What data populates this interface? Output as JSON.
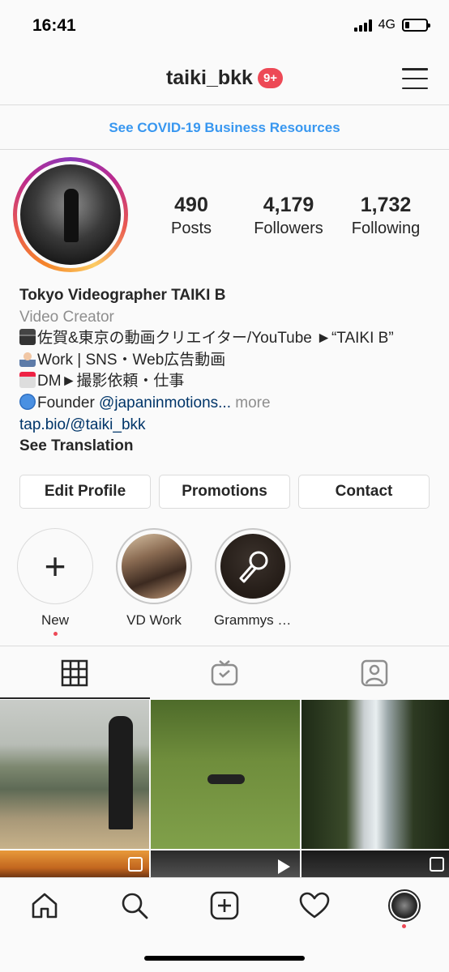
{
  "status_bar": {
    "time": "16:41",
    "network": "4G",
    "battery_level": 0.2
  },
  "header": {
    "username": "taiki_bkk",
    "notification_badge": "9+",
    "menu_icon": "hamburger-menu-icon"
  },
  "banner": {
    "text": "See COVID-19 Business Resources"
  },
  "stats": [
    {
      "number": "490",
      "label": "Posts"
    },
    {
      "number": "4,179",
      "label": "Followers"
    },
    {
      "number": "1,732",
      "label": "Following"
    }
  ],
  "bio": {
    "name": "Tokyo Videographer TAIKI B",
    "category": "Video Creator",
    "line1": "佐賀&東京の動画クリエイター/YouTube ►“TAIKI B”",
    "line2": "Work | SNS・Web広告動画",
    "line3": "DM►撮影依頼・仕事",
    "line4_prefix": "Founder ",
    "line4_mention": "@japaninmotions...",
    "line4_more": " more",
    "link": "tap.bio/@taiki_bkk",
    "see_translation": "See Translation"
  },
  "actions": {
    "edit_profile": "Edit Profile",
    "promotions": "Promotions",
    "contact": "Contact"
  },
  "highlights": [
    {
      "label": "New",
      "icon": "plus-icon"
    },
    {
      "label": "VD Work"
    },
    {
      "label": "Grammys 2..."
    }
  ],
  "tabs": [
    {
      "icon": "grid-icon",
      "active": true
    },
    {
      "icon": "igtv-icon",
      "active": false
    },
    {
      "icon": "tagged-icon",
      "active": false
    }
  ],
  "bottom_nav": [
    {
      "icon": "home-icon"
    },
    {
      "icon": "search-icon"
    },
    {
      "icon": "new-post-icon"
    },
    {
      "icon": "activity-heart-icon"
    },
    {
      "icon": "profile-avatar"
    }
  ],
  "colors": {
    "accent_link": "#3897f0",
    "badge_red": "#ed4956",
    "mention_blue": "#003569",
    "text": "#262626",
    "muted": "#8e8e8e"
  }
}
